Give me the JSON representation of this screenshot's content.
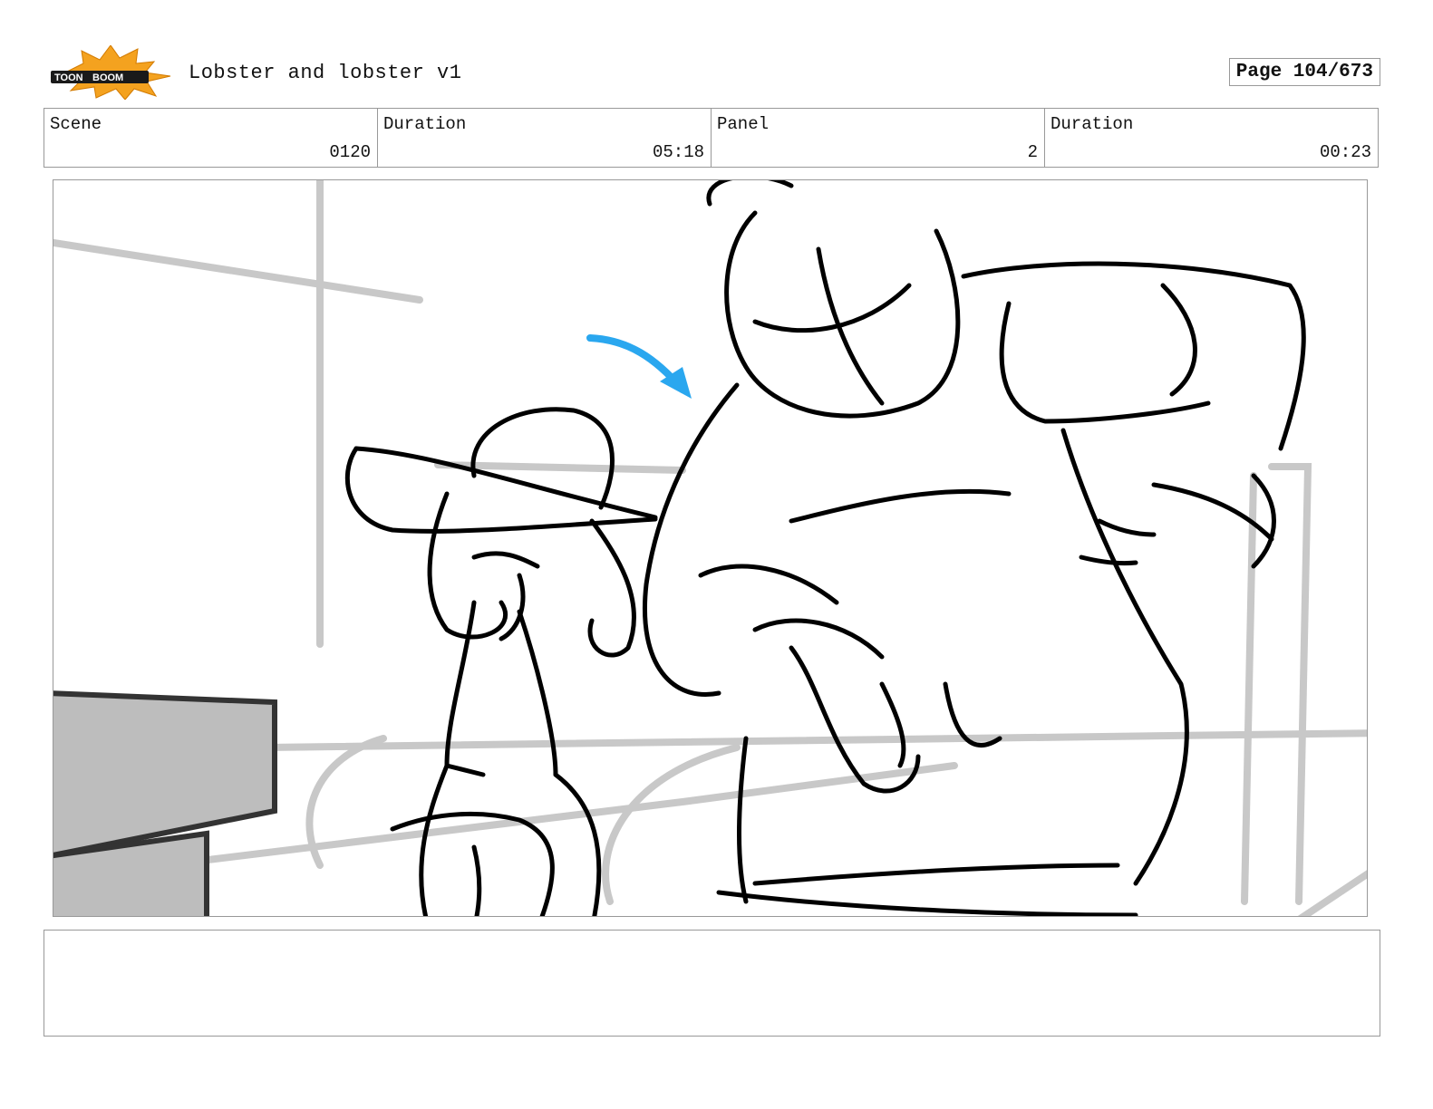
{
  "header": {
    "logo_text": "TOONBOOM",
    "project_title": "Lobster and lobster v1",
    "page_label": "Page 104/673"
  },
  "info": [
    {
      "label": "Scene",
      "value": "0120"
    },
    {
      "label": "Duration",
      "value": "05:18"
    },
    {
      "label": "Panel",
      "value": "2"
    },
    {
      "label": "Duration",
      "value": "00:23"
    }
  ],
  "colors": {
    "logo_burst": "#f4a21f",
    "arrow": "#2aa7ef",
    "sketch_gray": "#c8c8c8",
    "line": "#000000"
  },
  "notes": {
    "text": ""
  }
}
